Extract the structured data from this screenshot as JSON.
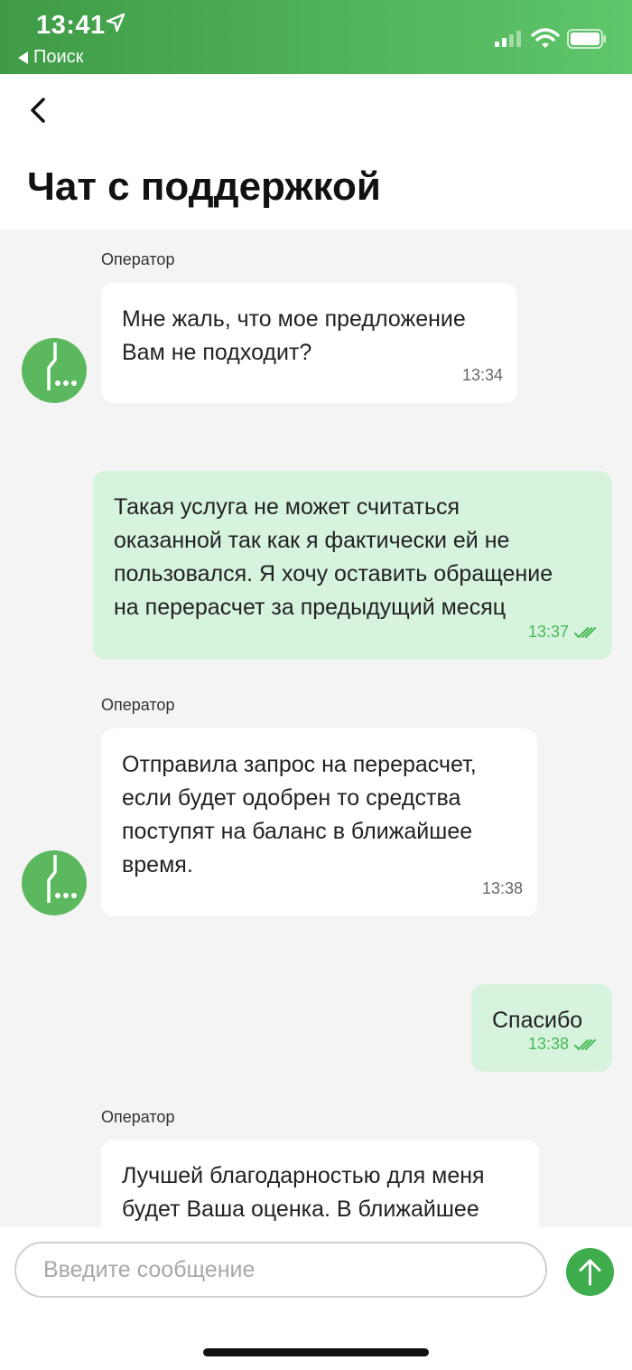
{
  "status_bar": {
    "time": "13:41",
    "back_label": "Поиск",
    "icons": [
      "location-arrow-icon",
      "cellular-signal-icon",
      "wifi-icon",
      "battery-icon"
    ]
  },
  "header": {
    "back_icon": "chevron-left-icon",
    "title": "Чат с поддержкой"
  },
  "colors": {
    "brand_green": "#3fad4e",
    "status_gradient_start": "#3f9b46",
    "status_gradient_end": "#5fc66a",
    "outgoing_bubble": "#d6f3de",
    "incoming_bubble": "#ffffff",
    "chat_background": "#f4f4f4"
  },
  "messages": [
    {
      "direction": "in",
      "sender": "Оператор",
      "text": "Мне жаль, что мое предложение\nВам не подходит?",
      "time": "13:34"
    },
    {
      "direction": "out",
      "text": "Такая услуга не может считаться\nоказанной так как я фактически ей не\nпользовался. Я хочу оставить обращение\nна перерасчет за предыдущий месяц",
      "time": "13:37",
      "status_icon": "double-check-icon"
    },
    {
      "direction": "in",
      "sender": "Оператор",
      "text": "Отправила запрос на перерасчет,\nесли будет одобрен то средства\nпоступят на баланс в ближайшее\nвремя.",
      "time": "13:38"
    },
    {
      "direction": "out",
      "text": "Спасибо",
      "time": "13:38",
      "status_icon": "double-check-icon"
    },
    {
      "direction": "in",
      "sender": "Оператор",
      "text": "Лучшей благодарностью для меня\nбудет Ваша оценка. В ближайшее",
      "time": ""
    }
  ],
  "composer": {
    "placeholder": "Введите сообщение",
    "value": "",
    "send_icon": "arrow-up-icon"
  }
}
